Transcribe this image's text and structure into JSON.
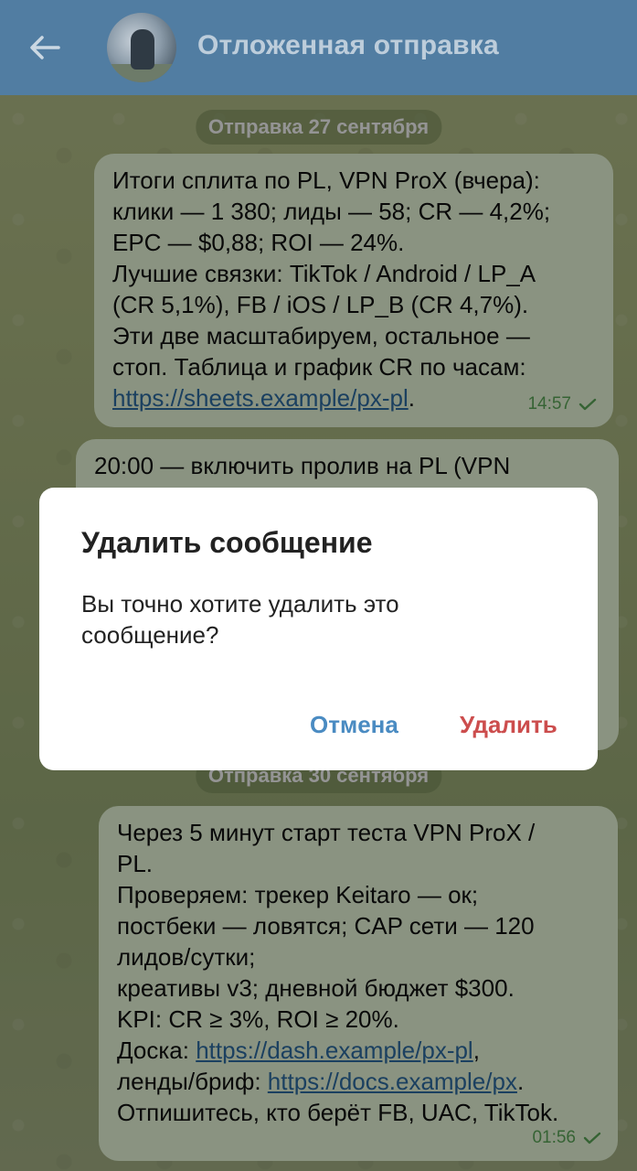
{
  "header": {
    "title": "Отложенная отправка"
  },
  "messages": [
    {
      "date": "Отправка 27 сентября",
      "lines": [
        "Итоги сплита по PL, VPN ProX (вчера):",
        "клики — 1 380; лиды — 58; CR — 4,2%;",
        "EPC — $0,88; ROI — 24%.",
        "Лучшие связки: TikTok / Android / LP_A",
        "(CR 5,1%), FB / iOS / LP_B (CR 4,7%).",
        "Эти две масштабируем, остальное —",
        "стоп. Таблица и график CR по часам:"
      ],
      "link": "https://sheets.example/px-pl",
      "link_suffix": ".",
      "time": "14:57"
    },
    {
      "line1": "20:00 — включить пролив на PL (VPN"
    },
    {
      "date": "Отправка 30 сентября",
      "lines": [
        "Через 5 минут старт теста VPN ProX /",
        "PL.",
        "Проверяем: трекер Keitaro — ок;",
        "постбеки — ловятся; CAP сети — 120",
        "лидов/сутки;",
        "креативы v3; дневной бюджет $300.",
        "KPI: CR ≥ 3%, ROI ≥ 20%."
      ],
      "doska_prefix": "Доска: ",
      "doska_link": "https://dash.example/px-pl",
      "doska_suffix": ",",
      "lendy_prefix": "ленды/бриф: ",
      "lendy_link": "https://docs.example/px",
      "lendy_suffix": ".",
      "last_line": "Отпишитесь, кто берёт FB, UAC, TikTok.",
      "time": "01:56"
    }
  ],
  "dialog": {
    "title": "Удалить сообщение",
    "text_line1": "Вы точно хотите удалить это",
    "text_line2": "сообщение?",
    "cancel": "Отмена",
    "delete": "Удалить"
  },
  "colors": {
    "header": "#517da2",
    "bubble": "#eefedf",
    "link": "#2f6ea6",
    "cancel": "#4a8bc2",
    "delete": "#cc4d4d",
    "check": "#5dab5a"
  },
  "icons": {
    "back": "arrow-left",
    "status": "single-check"
  }
}
